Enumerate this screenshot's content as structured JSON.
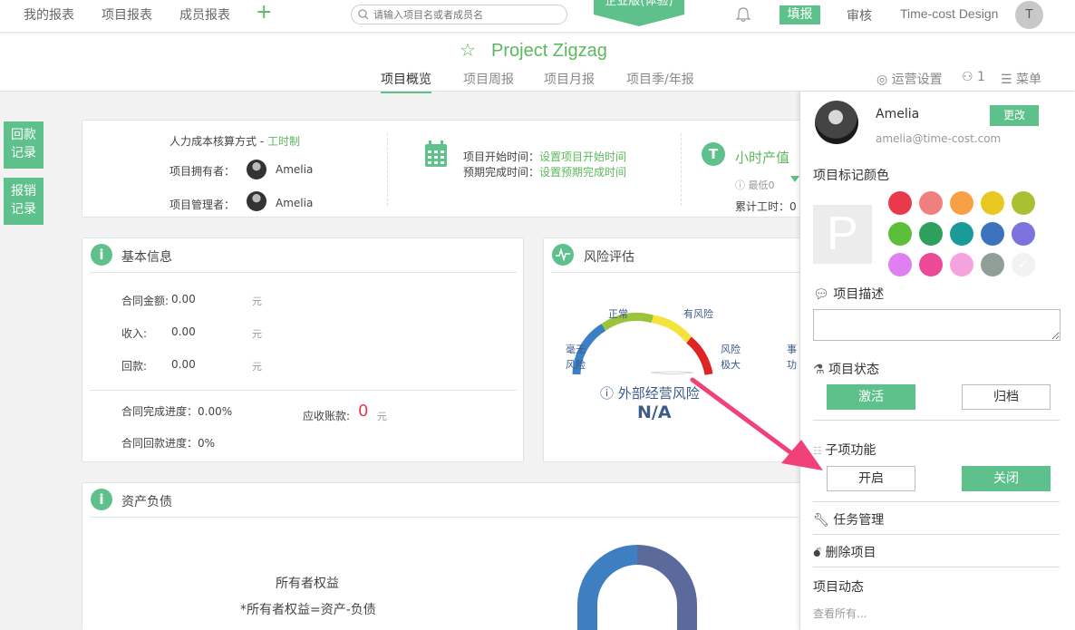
{
  "topbar": {
    "nav": [
      "我的报表",
      "项目报表",
      "成员报表"
    ],
    "add_label": "+",
    "search_placeholder": "请输入项目名或者成员名",
    "edition": "企业版(体验)",
    "fill_label": "填报",
    "review_label": "审核",
    "company": "Time-cost Design",
    "avatar_initial": "T"
  },
  "project": {
    "title": "Project Zigzag",
    "tabs": [
      "项目概览",
      "项目周报",
      "项目月报",
      "项目季/年报"
    ],
    "ops_settings": "运营设置",
    "member_count": "1",
    "menu_label": "菜单"
  },
  "side_buttons": [
    "回款\n记录",
    "报销\n记录"
  ],
  "summary": {
    "cost_method_label": "人力成本核算方式 - ",
    "cost_method_value": "工时制",
    "owner_label": "项目拥有者：",
    "owner_name": "Amelia",
    "manager_label": "项目管理者：",
    "manager_name": "Amelia",
    "start_label": "项目开始时间：",
    "start_value": "设置项目开始时间",
    "end_label": "预期完成时间：",
    "end_value": "设置预期完成时间",
    "hourly_title": "小时产值",
    "hourly_min": "最低0",
    "total_hours": "累计工时：0"
  },
  "basic_info": {
    "title": "基本信息",
    "rows": [
      {
        "label": "合同金额:",
        "value": "0.00",
        "unit": "元"
      },
      {
        "label": "收入:",
        "value": "0.00",
        "unit": "元"
      },
      {
        "label": "回款:",
        "value": "0.00",
        "unit": "元"
      }
    ],
    "completion": "合同完成进度：0.00%",
    "collection": "合同回款进度：0%",
    "receivable_label": "应收账款:",
    "receivable_value": "0",
    "receivable_unit": "元"
  },
  "risk": {
    "title": "风险评估",
    "labels": {
      "none": "毫无\n风险",
      "normal": "正常",
      "risky": "有风险",
      "extreme": "风险\n极大",
      "partial": "事\n功"
    },
    "external_label": "外部经营风险",
    "value": "N/A",
    "colors": [
      "#3b7fc4",
      "#9bc33b",
      "#f3e33a",
      "#e02424"
    ]
  },
  "assets": {
    "title": "资产负债",
    "equity": "所有者权益",
    "formula": "*所有者权益=资产-负债",
    "colors": [
      "#5a6a9a",
      "#3e7fc2"
    ]
  },
  "panel": {
    "user": "Amelia",
    "email": "amelia@time-cost.com",
    "change_label": "更改",
    "color_label": "项目标记颜色",
    "letter": "P",
    "colors": [
      "#e8394b",
      "#f08080",
      "#f7a144",
      "#e9c823",
      "#a9c032",
      "#5cbf3a",
      "#2ea05c",
      "#1b9a9a",
      "#3c73bd",
      "#7d73df",
      "#df7ff0",
      "#eb4a96",
      "#f4a3de",
      "#8f9f98",
      "#f2f2f2"
    ],
    "desc_label": "项目描述",
    "status_label": "项目状态",
    "activate": "激活",
    "archive": "归档",
    "sub_label": "子项功能",
    "open": "开启",
    "close": "关闭",
    "task_mgmt": "任务管理",
    "delete": "删除项目",
    "activity": "项目动态",
    "view_all": "查看所有..."
  },
  "annotation": {
    "arrow_color": "#f0417a"
  }
}
